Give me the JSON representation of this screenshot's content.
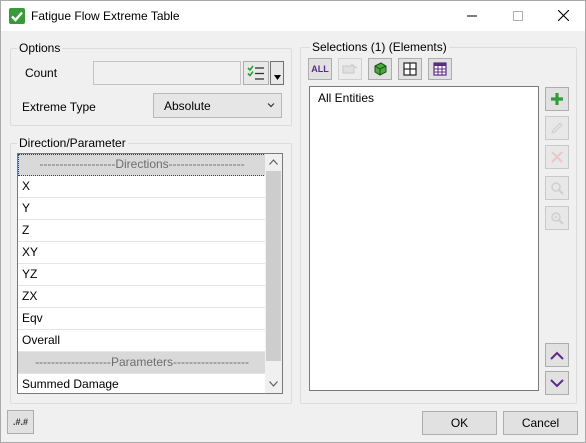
{
  "window": {
    "title": "Fatigue Flow Extreme Table",
    "controls": [
      "minimize-icon",
      "maximize-icon",
      "close-icon"
    ]
  },
  "options": {
    "group_label": "Options",
    "count_label": "Count",
    "count_value": "",
    "extreme_type_label": "Extreme Type",
    "extreme_type_value": "Absolute"
  },
  "direction": {
    "group_label": "Direction/Parameter",
    "rows": [
      {
        "label": "-------------------Directions-------------------",
        "kind": "header"
      },
      {
        "label": "X",
        "kind": "item"
      },
      {
        "label": "Y",
        "kind": "item"
      },
      {
        "label": "Z",
        "kind": "item"
      },
      {
        "label": "XY",
        "kind": "item"
      },
      {
        "label": "YZ",
        "kind": "item"
      },
      {
        "label": "ZX",
        "kind": "item"
      },
      {
        "label": "Eqv",
        "kind": "item"
      },
      {
        "label": "Overall",
        "kind": "item"
      },
      {
        "label": "-------------------Parameters-------------------",
        "kind": "header"
      },
      {
        "label": "Summed Damage",
        "kind": "item"
      }
    ]
  },
  "selections": {
    "group_label": "Selections (1) (Elements)",
    "toolbar": {
      "all_label": "ALL"
    },
    "entities": [
      "All Entities"
    ]
  },
  "buttons": {
    "ok": "OK",
    "cancel": "Cancel",
    "precision": ".#.#"
  },
  "colors": {
    "accent_green": "#2e9e35",
    "header_row": "#d9d9d9",
    "scroll_thumb": "#cdcdcd",
    "arrow_purple": "#5b2a86"
  }
}
